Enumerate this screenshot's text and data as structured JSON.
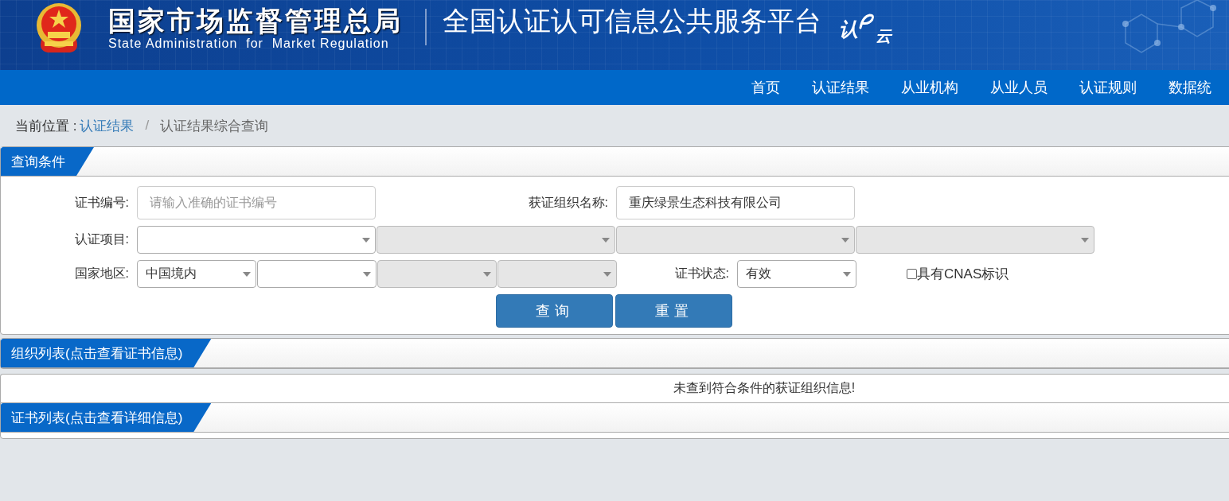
{
  "header": {
    "agency_name": "国家市场监督管理总局",
    "agency_name_en": "State Administration  for  Market Regulation",
    "platform_title": "全国认证认可信息公共服务平台",
    "logo_text": [
      "认",
      "云"
    ]
  },
  "nav": [
    "首页",
    "认证结果",
    "从业机构",
    "从业人员",
    "认证规则",
    "数据统"
  ],
  "breadcrumb": {
    "prefix": "当前位置 :",
    "separator": "/",
    "items": [
      {
        "label": "认证结果",
        "kind": "link"
      },
      {
        "label": "认证结果综合查询",
        "kind": "current"
      }
    ]
  },
  "query_panel": {
    "title": "查询条件",
    "certificate_number": {
      "label": "证书编号:",
      "placeholder": "请输入准确的证书编号"
    },
    "organization_name": {
      "label": "获证组织名称:",
      "value": "重庆绿景生态科技有限公司"
    },
    "certification_project": {
      "label": "认证项目:",
      "selects": [
        {
          "disabled": false
        },
        {
          "disabled": true
        },
        {
          "disabled": true
        },
        {
          "disabled": true
        }
      ]
    },
    "country_region": {
      "label": "国家地区:",
      "selects": [
        {
          "value": "中国境内",
          "disabled": false
        },
        {
          "disabled": false
        },
        {
          "disabled": true
        },
        {
          "disabled": true
        }
      ]
    },
    "certificate_status": {
      "label": "证书状态:",
      "value": "有效"
    },
    "cnas_mark": {
      "label": "具有CNAS标识",
      "checked": false
    },
    "buttons": [
      "查询",
      "重置"
    ]
  },
  "organization_list": {
    "title": "组织列表(点击查看证书信息)",
    "empty_message": "未查到符合条件的获证组织信息!"
  },
  "certificate_list": {
    "title": "证书列表(点击查看详细信息)"
  }
}
